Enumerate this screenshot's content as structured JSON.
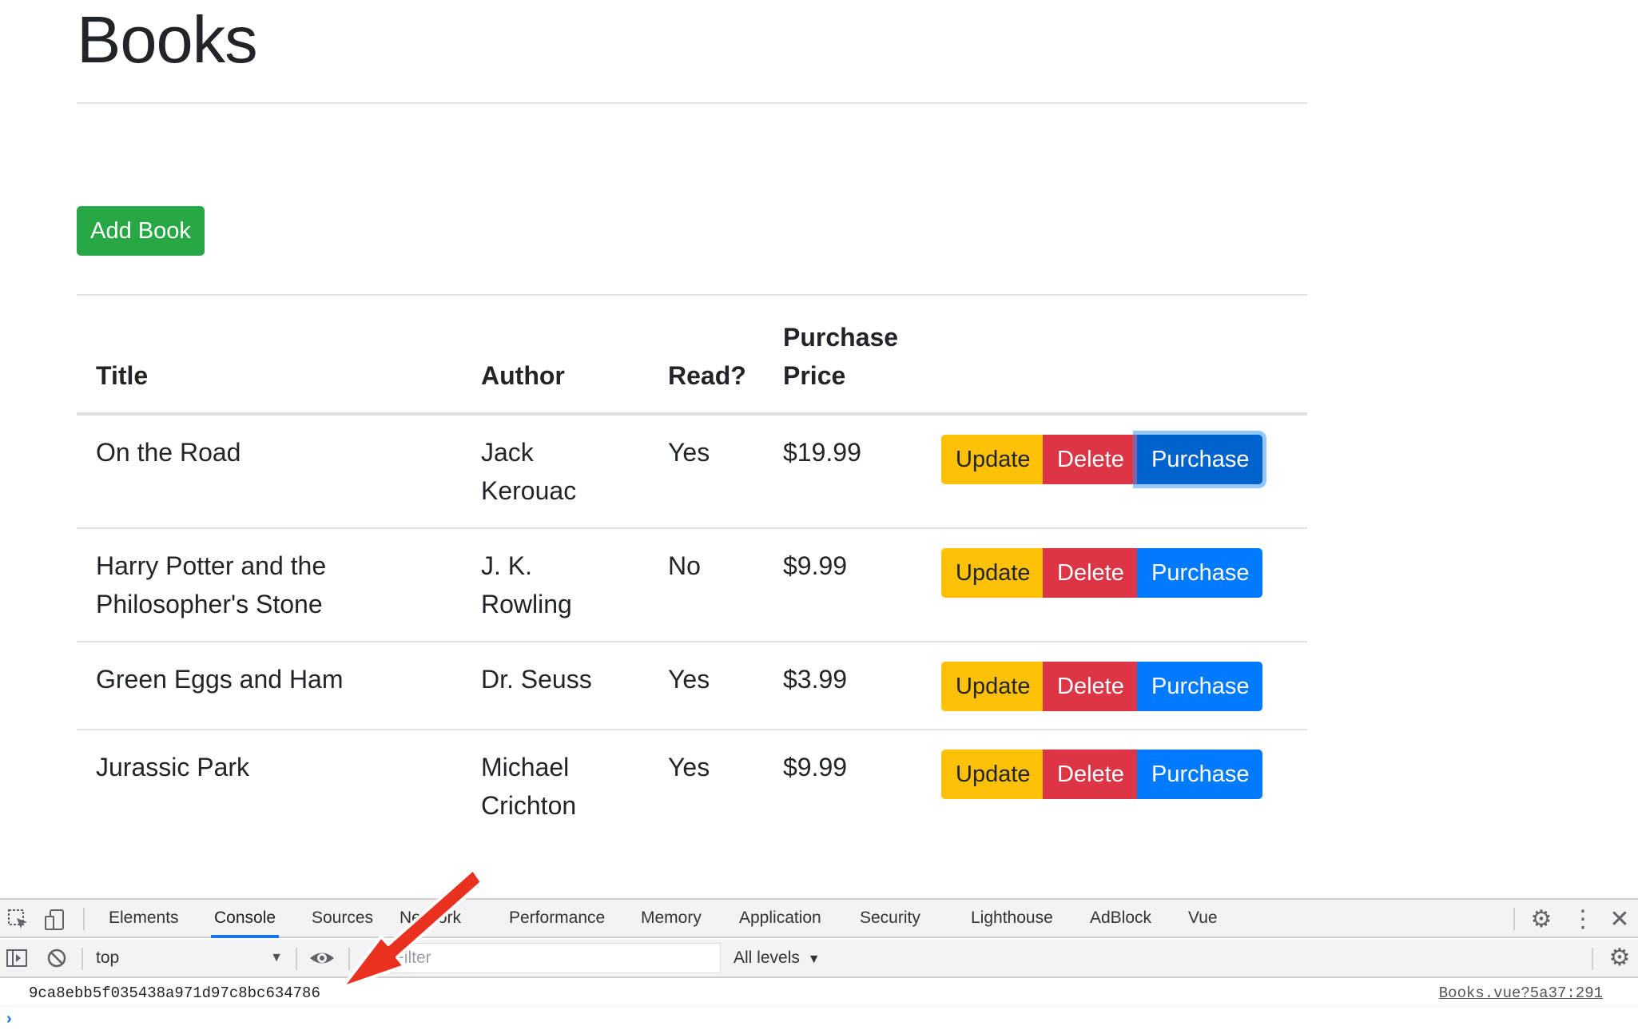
{
  "page": {
    "title": "Books",
    "add_button_label": "Add Book"
  },
  "table": {
    "headers": {
      "title": "Title",
      "author": "Author",
      "read": "Read?",
      "price": "Purchase Price"
    },
    "rows": [
      {
        "title": "On the Road",
        "author": "Jack Kerouac",
        "read": "Yes",
        "price": "$19.99"
      },
      {
        "title": "Harry Potter and the Philosopher's Stone",
        "author": "J. K. Rowling",
        "read": "No",
        "price": "$9.99"
      },
      {
        "title": "Green Eggs and Ham",
        "author": "Dr. Seuss",
        "read": "Yes",
        "price": "$3.99"
      },
      {
        "title": "Jurassic Park",
        "author": "Michael Crichton",
        "read": "Yes",
        "price": "$9.99"
      }
    ],
    "actions": {
      "update": "Update",
      "delete": "Delete",
      "purchase": "Purchase"
    }
  },
  "devtools": {
    "tabs": [
      "Elements",
      "Console",
      "Sources",
      "Network",
      "Performance",
      "Memory",
      "Application",
      "Security",
      "Lighthouse",
      "AdBlock",
      "Vue"
    ],
    "active_tab": "Console",
    "context": "top",
    "filter_placeholder": "Filter",
    "levels": "All levels",
    "log": {
      "message": "9ca8ebb5f035438a971d97c8bc634786",
      "source": "Books.vue?5a37:291"
    }
  },
  "colors": {
    "success": "#28a745",
    "warning": "#ffc107",
    "danger": "#dc3545",
    "primary": "#007bff",
    "annotation_arrow": "#e8321f"
  }
}
